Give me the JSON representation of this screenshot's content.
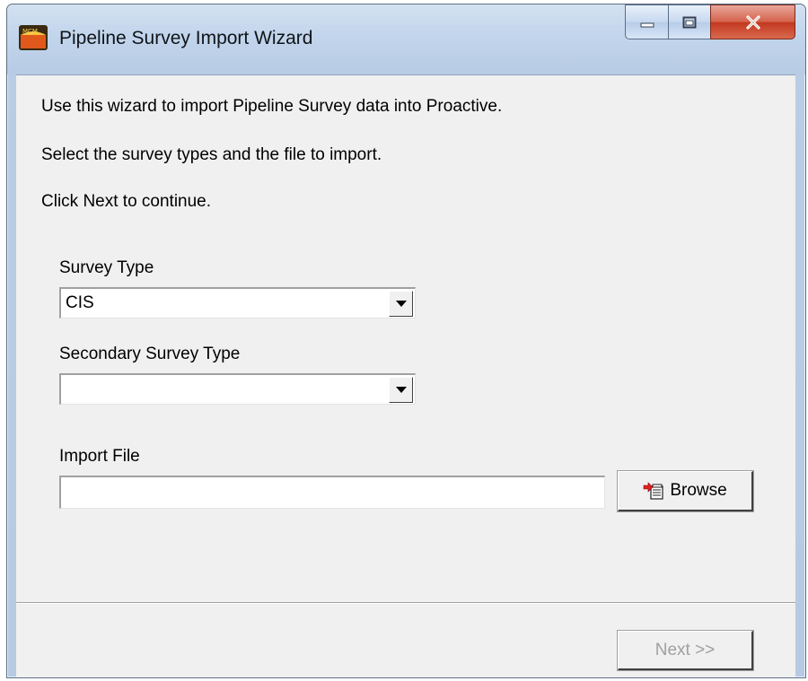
{
  "window": {
    "title": "Pipeline Survey Import Wizard",
    "app_icon": "mcm-app-icon"
  },
  "title_controls": {
    "minimize_icon": "minimize-icon",
    "maximize_icon": "maximize-icon",
    "close_icon": "close-icon"
  },
  "intro": {
    "line1": "Use this wizard to import Pipeline Survey data into Proactive.",
    "line2": "Select the survey types and the file to import.",
    "line3": "Click Next to continue."
  },
  "survey_type": {
    "label": "Survey Type",
    "value": "CIS"
  },
  "secondary_survey_type": {
    "label": "Secondary Survey Type",
    "value": ""
  },
  "import_file": {
    "label": "Import File",
    "value": ""
  },
  "browse_button": {
    "label": "Browse",
    "icon": "browse-file-icon"
  },
  "footer": {
    "next_label": "Next >>",
    "next_enabled": false
  }
}
